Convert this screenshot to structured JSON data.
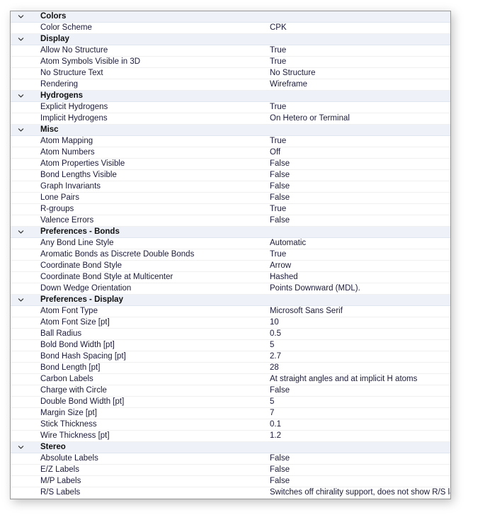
{
  "panel": {
    "name": "property-grid",
    "collapse_icon": "chevron-down-icon",
    "groups": [
      {
        "label": "Colors",
        "expanded": true,
        "rows": [
          {
            "name": "Color Scheme",
            "value": "CPK"
          }
        ]
      },
      {
        "label": "Display",
        "expanded": true,
        "rows": [
          {
            "name": "Allow No Structure",
            "value": "True"
          },
          {
            "name": "Atom Symbols Visible in 3D",
            "value": "True"
          },
          {
            "name": "No Structure Text",
            "value": "No Structure"
          },
          {
            "name": "Rendering",
            "value": "Wireframe"
          }
        ]
      },
      {
        "label": "Hydrogens",
        "expanded": true,
        "rows": [
          {
            "name": "Explicit Hydrogens",
            "value": "True"
          },
          {
            "name": "Implicit Hydrogens",
            "value": "On Hetero or Terminal"
          }
        ]
      },
      {
        "label": "Misc",
        "expanded": true,
        "rows": [
          {
            "name": "Atom Mapping",
            "value": "True"
          },
          {
            "name": "Atom Numbers",
            "value": "Off"
          },
          {
            "name": "Atom Properties Visible",
            "value": "False"
          },
          {
            "name": "Bond Lengths Visible",
            "value": "False"
          },
          {
            "name": "Graph Invariants",
            "value": "False"
          },
          {
            "name": "Lone Pairs",
            "value": "False"
          },
          {
            "name": "R-groups",
            "value": "True"
          },
          {
            "name": "Valence Errors",
            "value": "False"
          }
        ]
      },
      {
        "label": "Preferences - Bonds",
        "expanded": true,
        "rows": [
          {
            "name": "Any Bond Line Style",
            "value": "Automatic"
          },
          {
            "name": "Aromatic Bonds as Discrete Double Bonds",
            "value": "True"
          },
          {
            "name": "Coordinate Bond Style",
            "value": "Arrow"
          },
          {
            "name": "Coordinate Bond Style at Multicenter",
            "value": "Hashed"
          },
          {
            "name": "Down Wedge Orientation",
            "value": "Points Downward (MDL)."
          }
        ]
      },
      {
        "label": "Preferences - Display",
        "expanded": true,
        "rows": [
          {
            "name": "Atom Font Type",
            "value": "Microsoft Sans Serif"
          },
          {
            "name": "Atom Font Size [pt]",
            "value": "10"
          },
          {
            "name": "Ball Radius",
            "value": "0.5"
          },
          {
            "name": "Bold Bond Width [pt]",
            "value": "5"
          },
          {
            "name": "Bond Hash Spacing [pt]",
            "value": "2.7"
          },
          {
            "name": "Bond Length [pt]",
            "value": "28"
          },
          {
            "name": "Carbon Labels",
            "value": "At straight angles and at implicit H atoms"
          },
          {
            "name": "Charge with Circle",
            "value": "False"
          },
          {
            "name": "Double Bond Width [pt]",
            "value": "5"
          },
          {
            "name": "Margin Size [pt]",
            "value": "7"
          },
          {
            "name": "Stick Thickness",
            "value": "0.1"
          },
          {
            "name": "Wire Thickness [pt]",
            "value": "1.2"
          }
        ]
      },
      {
        "label": "Stereo",
        "expanded": true,
        "rows": [
          {
            "name": "Absolute Labels",
            "value": "False"
          },
          {
            "name": "E/Z Labels",
            "value": "False"
          },
          {
            "name": "M/P Labels",
            "value": "False"
          },
          {
            "name": "R/S Labels",
            "value": "Switches off chirality support, does not show R/S labels."
          }
        ]
      }
    ]
  },
  "colors": {
    "group_row_background": "#eef2f8",
    "row_background": "#ffffff",
    "row_separator": "#f0f0f0",
    "text": "#1b1b3a",
    "group_text": "#101010",
    "panel_border": "#9a9a9a"
  }
}
